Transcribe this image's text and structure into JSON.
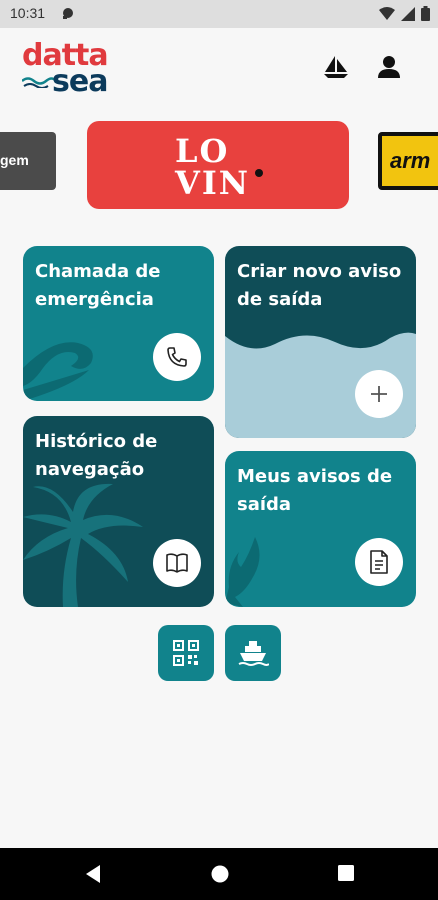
{
  "status_bar": {
    "time": "10:31",
    "icons": [
      "notification-icon",
      "wifi-icon",
      "signal-icon",
      "battery-icon"
    ]
  },
  "header": {
    "logo_top": "datta",
    "logo_bottom": "sea",
    "icons": [
      "sailboat-icon",
      "user-icon"
    ]
  },
  "carousel": {
    "left_banner_text": "gem",
    "center_banner_text_line1": "LO",
    "center_banner_text_line2": "VIN",
    "right_banner_text": "arm"
  },
  "cards": {
    "emergency": {
      "title": "Chamada de emergência",
      "icon": "phone-icon"
    },
    "new_notice": {
      "title": "Criar novo aviso de saída",
      "icon": "plus-icon"
    },
    "history": {
      "title": "Histórico de navegação",
      "icon": "book-icon"
    },
    "my_notices": {
      "title": "Meus avisos de saída",
      "icon": "document-icon"
    }
  },
  "actions": {
    "qr_icon": "qr-code-icon",
    "ship_icon": "ship-icon"
  },
  "colors": {
    "teal": "#11838c",
    "dark_teal": "#0f4d57",
    "light_blue": "#a9cdd9",
    "brand_red": "#e03a3e",
    "brand_navy": "#0c3b5c"
  }
}
